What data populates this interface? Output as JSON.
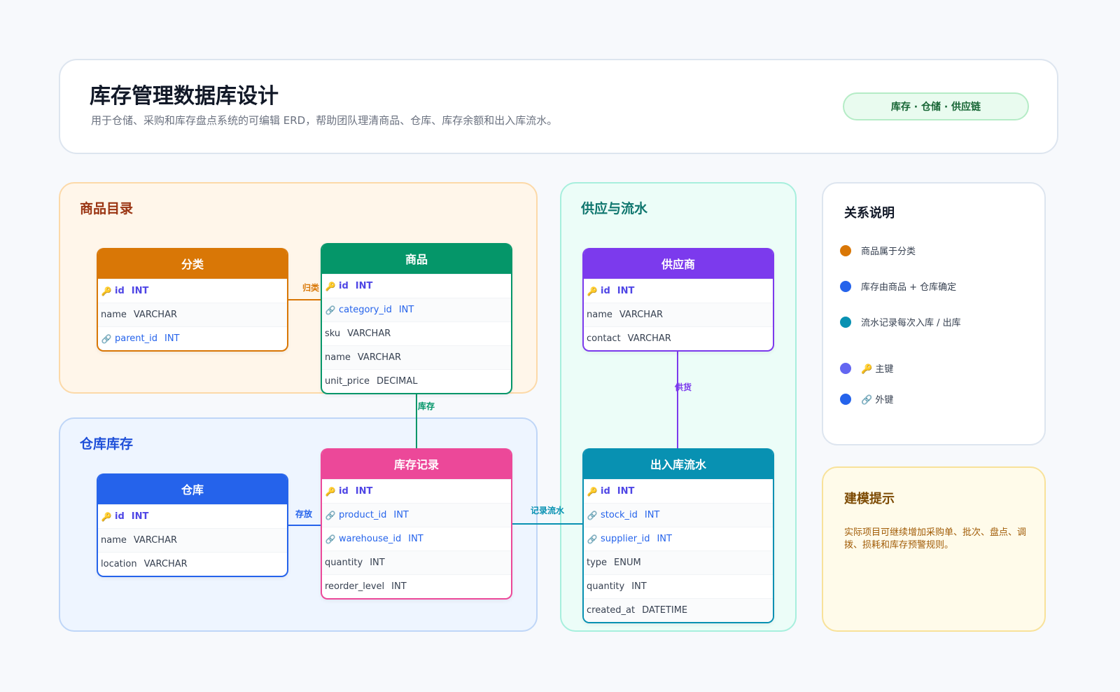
{
  "header": {
    "title": "库存管理数据库设计",
    "subtitle": "用于仓储、采购和库存盘点系统的可编辑 ERD，帮助团队理清商品、仓库、库存余额和出入库流水。",
    "tag": "库存 · 仓储 · 供应链"
  },
  "groups": {
    "product": "商品目录",
    "warehouse": "仓库库存",
    "supply": "供应与流水"
  },
  "entities": {
    "category": {
      "title": "分类",
      "color": "#d97706",
      "fields": [
        {
          "icon": "key-icon",
          "name": "id",
          "type": "INT",
          "kind": "pk"
        },
        {
          "icon": "",
          "name": "name",
          "type": "VARCHAR",
          "kind": ""
        },
        {
          "icon": "link-icon",
          "name": "parent_id",
          "type": "INT",
          "kind": "fk"
        }
      ]
    },
    "product": {
      "title": "商品",
      "color": "#059669",
      "fields": [
        {
          "icon": "key-icon",
          "name": "id",
          "type": "INT",
          "kind": "pk"
        },
        {
          "icon": "link-icon",
          "name": "category_id",
          "type": "INT",
          "kind": "fk"
        },
        {
          "icon": "",
          "name": "sku",
          "type": "VARCHAR",
          "kind": ""
        },
        {
          "icon": "",
          "name": "name",
          "type": "VARCHAR",
          "kind": ""
        },
        {
          "icon": "",
          "name": "unit_price",
          "type": "DECIMAL",
          "kind": ""
        }
      ]
    },
    "warehouse": {
      "title": "仓库",
      "color": "#2563eb",
      "fields": [
        {
          "icon": "key-icon",
          "name": "id",
          "type": "INT",
          "kind": "pk"
        },
        {
          "icon": "",
          "name": "name",
          "type": "VARCHAR",
          "kind": ""
        },
        {
          "icon": "",
          "name": "location",
          "type": "VARCHAR",
          "kind": ""
        }
      ]
    },
    "stock": {
      "title": "库存记录",
      "color": "#ec4899",
      "fields": [
        {
          "icon": "key-icon",
          "name": "id",
          "type": "INT",
          "kind": "pk"
        },
        {
          "icon": "link-icon",
          "name": "product_id",
          "type": "INT",
          "kind": "fk"
        },
        {
          "icon": "link-icon",
          "name": "warehouse_id",
          "type": "INT",
          "kind": "fk"
        },
        {
          "icon": "",
          "name": "quantity",
          "type": "INT",
          "kind": ""
        },
        {
          "icon": "",
          "name": "reorder_level",
          "type": "INT",
          "kind": ""
        }
      ]
    },
    "supplier": {
      "title": "供应商",
      "color": "#7c3aed",
      "fields": [
        {
          "icon": "key-icon",
          "name": "id",
          "type": "INT",
          "kind": "pk"
        },
        {
          "icon": "",
          "name": "name",
          "type": "VARCHAR",
          "kind": ""
        },
        {
          "icon": "",
          "name": "contact",
          "type": "VARCHAR",
          "kind": ""
        }
      ]
    },
    "movement": {
      "title": "出入库流水",
      "color": "#0891b2",
      "fields": [
        {
          "icon": "key-icon",
          "name": "id",
          "type": "INT",
          "kind": "pk"
        },
        {
          "icon": "link-icon",
          "name": "stock_id",
          "type": "INT",
          "kind": "fk"
        },
        {
          "icon": "link-icon",
          "name": "supplier_id",
          "type": "INT",
          "kind": "fk"
        },
        {
          "icon": "",
          "name": "type",
          "type": "ENUM",
          "kind": ""
        },
        {
          "icon": "",
          "name": "quantity",
          "type": "INT",
          "kind": ""
        },
        {
          "icon": "",
          "name": "created_at",
          "type": "DATETIME",
          "kind": ""
        }
      ]
    }
  },
  "relations": {
    "belongs": {
      "label": "归类",
      "color": "#d97706"
    },
    "stock": {
      "label": "库存",
      "color": "#059669"
    },
    "store": {
      "label": "存放",
      "color": "#2563eb"
    },
    "log": {
      "label": "记录流水",
      "color": "#0891b2"
    },
    "supply": {
      "label": "供货",
      "color": "#7c3aed"
    }
  },
  "legend": {
    "title": "关系说明",
    "items": [
      {
        "color": "#d97706",
        "text": "商品属于分类"
      },
      {
        "color": "#2563eb",
        "text": "库存由商品 + 仓库确定"
      },
      {
        "color": "#0891b2",
        "text": "流水记录每次入库 / 出库"
      },
      {
        "color": "#6366f1",
        "text": "🔑 主键"
      },
      {
        "color": "#2563eb",
        "text": "🔗 外键"
      }
    ]
  },
  "tip": {
    "title": "建模提示",
    "text": "实际项目可继续增加采购单、批次、盘点、调拨、损耗和库存预警规则。"
  }
}
